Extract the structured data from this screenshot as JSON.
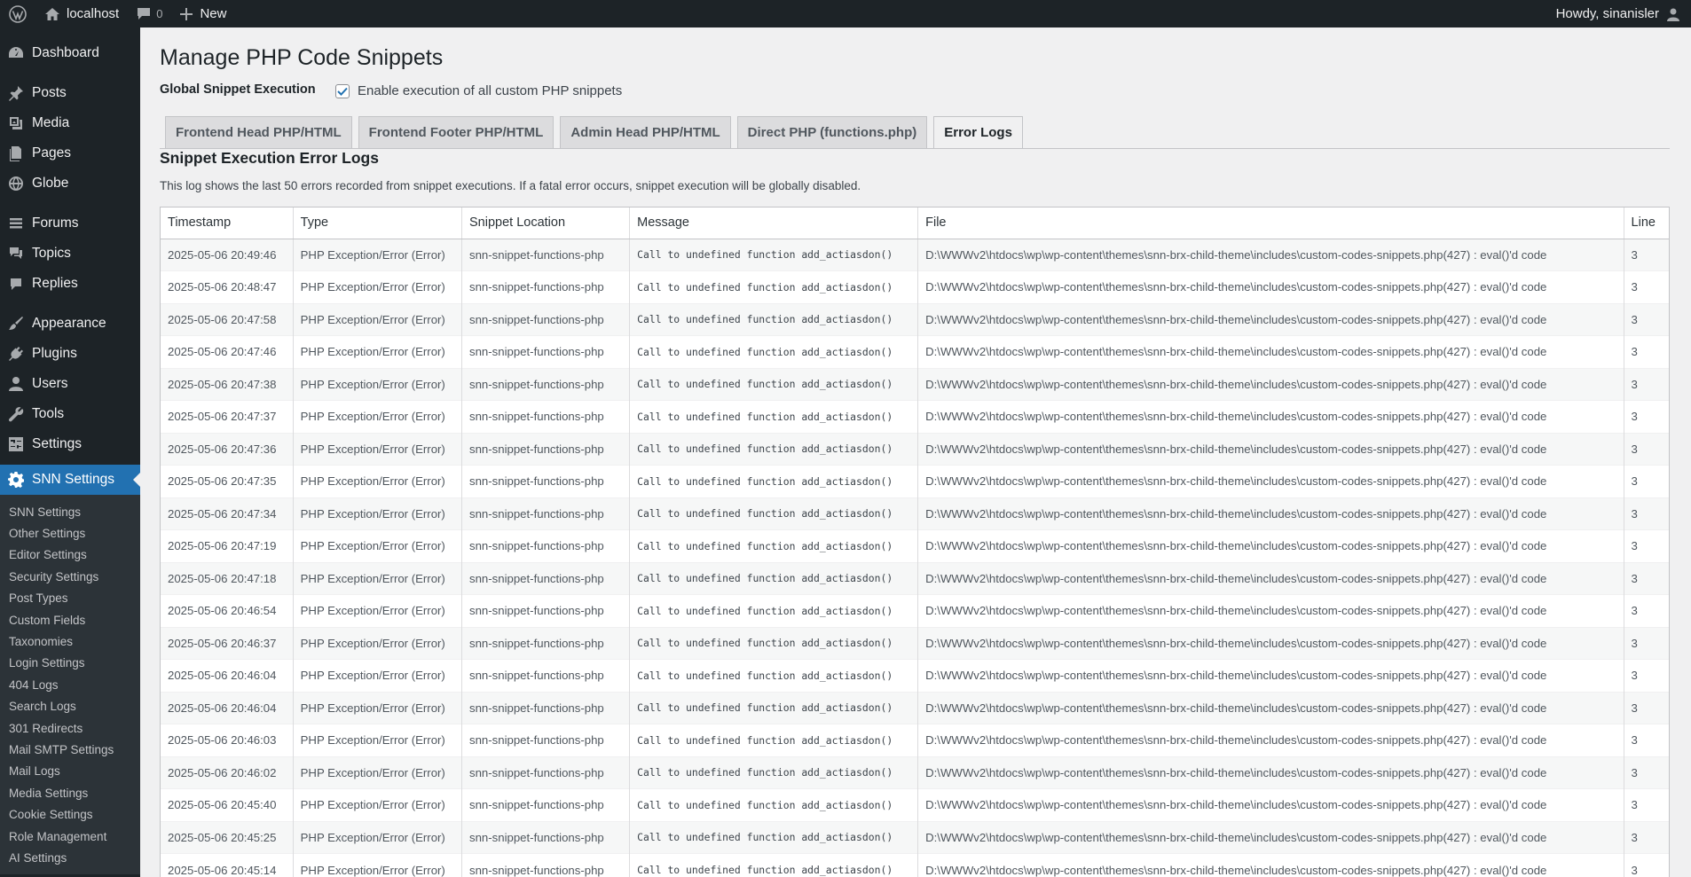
{
  "adminbar": {
    "site_name": "localhost",
    "comments_count": "0",
    "new_label": "New",
    "howdy": "Howdy, sinanisler"
  },
  "sidebar": {
    "groups": [
      [
        {
          "label": "Dashboard",
          "icon": "dashboard-icon"
        }
      ],
      [
        {
          "label": "Posts",
          "icon": "pin-icon"
        },
        {
          "label": "Media",
          "icon": "media-icon"
        },
        {
          "label": "Pages",
          "icon": "pages-icon"
        },
        {
          "label": "Globe",
          "icon": "globe-icon"
        }
      ],
      [
        {
          "label": "Forums",
          "icon": "forums-icon"
        },
        {
          "label": "Topics",
          "icon": "topics-icon"
        },
        {
          "label": "Replies",
          "icon": "replies-icon"
        }
      ],
      [
        {
          "label": "Appearance",
          "icon": "brush-icon"
        },
        {
          "label": "Plugins",
          "icon": "plug-icon"
        },
        {
          "label": "Users",
          "icon": "user-icon"
        },
        {
          "label": "Tools",
          "icon": "wrench-icon"
        },
        {
          "label": "Settings",
          "icon": "settings-icon"
        }
      ]
    ],
    "current": {
      "label": "SNN Settings",
      "icon": "gear-icon"
    },
    "submenu": [
      "SNN Settings",
      "Other Settings",
      "Editor Settings",
      "Security Settings",
      "Post Types",
      "Custom Fields",
      "Taxonomies",
      "Login Settings",
      "404 Logs",
      "Search Logs",
      "301 Redirects",
      "Mail SMTP Settings",
      "Mail Logs",
      "Media Settings",
      "Cookie Settings",
      "Role Management",
      "AI Settings"
    ]
  },
  "page": {
    "title": "Manage PHP Code Snippets",
    "global_label": "Global Snippet Execution",
    "global_checkbox_label": "Enable execution of all custom PHP snippets",
    "global_checked": true,
    "tabs": [
      "Frontend Head PHP/HTML",
      "Frontend Footer PHP/HTML",
      "Admin Head PHP/HTML",
      "Direct PHP (functions.php)",
      "Error Logs"
    ],
    "active_tab": 4,
    "section_title": "Snippet Execution Error Logs",
    "section_desc": "This log shows the last 50 errors recorded from snippet executions. If a fatal error occurs, snippet execution will be globally disabled."
  },
  "log_table": {
    "columns": [
      "Timestamp",
      "Type",
      "Snippet Location",
      "Message",
      "File",
      "Line"
    ],
    "rows": [
      [
        "2025-05-06 20:49:46",
        "PHP Exception/Error (Error)",
        "snn-snippet-functions-php",
        "Call to undefined function add_actiasdon()",
        "D:\\WWWv2\\htdocs\\wp\\wp-content\\themes\\snn-brx-child-theme\\includes\\custom-codes-snippets.php(427) : eval()'d code",
        "3"
      ],
      [
        "2025-05-06 20:48:47",
        "PHP Exception/Error (Error)",
        "snn-snippet-functions-php",
        "Call to undefined function add_actiasdon()",
        "D:\\WWWv2\\htdocs\\wp\\wp-content\\themes\\snn-brx-child-theme\\includes\\custom-codes-snippets.php(427) : eval()'d code",
        "3"
      ],
      [
        "2025-05-06 20:47:58",
        "PHP Exception/Error (Error)",
        "snn-snippet-functions-php",
        "Call to undefined function add_actiasdon()",
        "D:\\WWWv2\\htdocs\\wp\\wp-content\\themes\\snn-brx-child-theme\\includes\\custom-codes-snippets.php(427) : eval()'d code",
        "3"
      ],
      [
        "2025-05-06 20:47:46",
        "PHP Exception/Error (Error)",
        "snn-snippet-functions-php",
        "Call to undefined function add_actiasdon()",
        "D:\\WWWv2\\htdocs\\wp\\wp-content\\themes\\snn-brx-child-theme\\includes\\custom-codes-snippets.php(427) : eval()'d code",
        "3"
      ],
      [
        "2025-05-06 20:47:38",
        "PHP Exception/Error (Error)",
        "snn-snippet-functions-php",
        "Call to undefined function add_actiasdon()",
        "D:\\WWWv2\\htdocs\\wp\\wp-content\\themes\\snn-brx-child-theme\\includes\\custom-codes-snippets.php(427) : eval()'d code",
        "3"
      ],
      [
        "2025-05-06 20:47:37",
        "PHP Exception/Error (Error)",
        "snn-snippet-functions-php",
        "Call to undefined function add_actiasdon()",
        "D:\\WWWv2\\htdocs\\wp\\wp-content\\themes\\snn-brx-child-theme\\includes\\custom-codes-snippets.php(427) : eval()'d code",
        "3"
      ],
      [
        "2025-05-06 20:47:36",
        "PHP Exception/Error (Error)",
        "snn-snippet-functions-php",
        "Call to undefined function add_actiasdon()",
        "D:\\WWWv2\\htdocs\\wp\\wp-content\\themes\\snn-brx-child-theme\\includes\\custom-codes-snippets.php(427) : eval()'d code",
        "3"
      ],
      [
        "2025-05-06 20:47:35",
        "PHP Exception/Error (Error)",
        "snn-snippet-functions-php",
        "Call to undefined function add_actiasdon()",
        "D:\\WWWv2\\htdocs\\wp\\wp-content\\themes\\snn-brx-child-theme\\includes\\custom-codes-snippets.php(427) : eval()'d code",
        "3"
      ],
      [
        "2025-05-06 20:47:34",
        "PHP Exception/Error (Error)",
        "snn-snippet-functions-php",
        "Call to undefined function add_actiasdon()",
        "D:\\WWWv2\\htdocs\\wp\\wp-content\\themes\\snn-brx-child-theme\\includes\\custom-codes-snippets.php(427) : eval()'d code",
        "3"
      ],
      [
        "2025-05-06 20:47:19",
        "PHP Exception/Error (Error)",
        "snn-snippet-functions-php",
        "Call to undefined function add_actiasdon()",
        "D:\\WWWv2\\htdocs\\wp\\wp-content\\themes\\snn-brx-child-theme\\includes\\custom-codes-snippets.php(427) : eval()'d code",
        "3"
      ],
      [
        "2025-05-06 20:47:18",
        "PHP Exception/Error (Error)",
        "snn-snippet-functions-php",
        "Call to undefined function add_actiasdon()",
        "D:\\WWWv2\\htdocs\\wp\\wp-content\\themes\\snn-brx-child-theme\\includes\\custom-codes-snippets.php(427) : eval()'d code",
        "3"
      ],
      [
        "2025-05-06 20:46:54",
        "PHP Exception/Error (Error)",
        "snn-snippet-functions-php",
        "Call to undefined function add_actiasdon()",
        "D:\\WWWv2\\htdocs\\wp\\wp-content\\themes\\snn-brx-child-theme\\includes\\custom-codes-snippets.php(427) : eval()'d code",
        "3"
      ],
      [
        "2025-05-06 20:46:37",
        "PHP Exception/Error (Error)",
        "snn-snippet-functions-php",
        "Call to undefined function add_actiasdon()",
        "D:\\WWWv2\\htdocs\\wp\\wp-content\\themes\\snn-brx-child-theme\\includes\\custom-codes-snippets.php(427) : eval()'d code",
        "3"
      ],
      [
        "2025-05-06 20:46:04",
        "PHP Exception/Error (Error)",
        "snn-snippet-functions-php",
        "Call to undefined function add_actiasdon()",
        "D:\\WWWv2\\htdocs\\wp\\wp-content\\themes\\snn-brx-child-theme\\includes\\custom-codes-snippets.php(427) : eval()'d code",
        "3"
      ],
      [
        "2025-05-06 20:46:04",
        "PHP Exception/Error (Error)",
        "snn-snippet-functions-php",
        "Call to undefined function add_actiasdon()",
        "D:\\WWWv2\\htdocs\\wp\\wp-content\\themes\\snn-brx-child-theme\\includes\\custom-codes-snippets.php(427) : eval()'d code",
        "3"
      ],
      [
        "2025-05-06 20:46:03",
        "PHP Exception/Error (Error)",
        "snn-snippet-functions-php",
        "Call to undefined function add_actiasdon()",
        "D:\\WWWv2\\htdocs\\wp\\wp-content\\themes\\snn-brx-child-theme\\includes\\custom-codes-snippets.php(427) : eval()'d code",
        "3"
      ],
      [
        "2025-05-06 20:46:02",
        "PHP Exception/Error (Error)",
        "snn-snippet-functions-php",
        "Call to undefined function add_actiasdon()",
        "D:\\WWWv2\\htdocs\\wp\\wp-content\\themes\\snn-brx-child-theme\\includes\\custom-codes-snippets.php(427) : eval()'d code",
        "3"
      ],
      [
        "2025-05-06 20:45:40",
        "PHP Exception/Error (Error)",
        "snn-snippet-functions-php",
        "Call to undefined function add_actiasdon()",
        "D:\\WWWv2\\htdocs\\wp\\wp-content\\themes\\snn-brx-child-theme\\includes\\custom-codes-snippets.php(427) : eval()'d code",
        "3"
      ],
      [
        "2025-05-06 20:45:25",
        "PHP Exception/Error (Error)",
        "snn-snippet-functions-php",
        "Call to undefined function add_actiasdon()",
        "D:\\WWWv2\\htdocs\\wp\\wp-content\\themes\\snn-brx-child-theme\\includes\\custom-codes-snippets.php(427) : eval()'d code",
        "3"
      ],
      [
        "2025-05-06 20:45:14",
        "PHP Exception/Error (Error)",
        "snn-snippet-functions-php",
        "Call to undefined function add_actiasdon()",
        "D:\\WWWv2\\htdocs\\wp\\wp-content\\themes\\snn-brx-child-theme\\includes\\custom-codes-snippets.php(427) : eval()'d code",
        "3"
      ]
    ]
  }
}
